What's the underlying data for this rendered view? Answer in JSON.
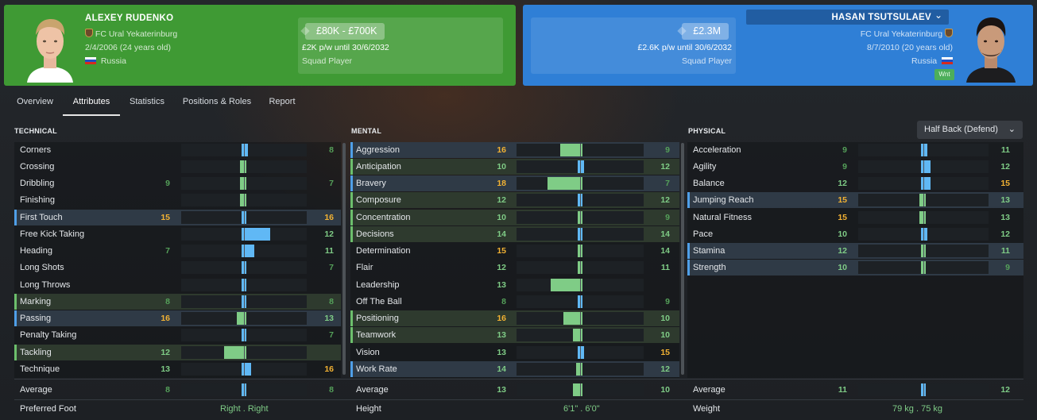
{
  "left_player": {
    "name": "ALEXEY RUDENKO",
    "club": "FC Ural Yekaterinburg",
    "dob": "2/4/2006 (24 years old)",
    "nationality": "Russia",
    "value": "£80K - £700K",
    "wage": "£2K p/w until 30/6/2032",
    "status": "Squad Player"
  },
  "right_player": {
    "name": "HASAN TSUTSULAEV",
    "club": "FC Ural Yekaterinburg",
    "dob": "8/7/2010 (20 years old)",
    "nationality": "Russia",
    "value": "£2.3M",
    "wage": "£2.6K p/w until 30/6/2032",
    "status": "Squad Player",
    "badge": "Wnt",
    "chevron": "⌄"
  },
  "tabs": [
    "Overview",
    "Attributes",
    "Statistics",
    "Positions & Roles",
    "Report"
  ],
  "active_tab": 1,
  "sections": {
    "technical": "TECHNICAL",
    "mental": "MENTAL",
    "physical": "PHYSICAL"
  },
  "role_dropdown": {
    "value": "Half Back (Defend)",
    "chevron": "⌄"
  },
  "colors": {
    "left_card": "#3f9a34",
    "right_card": "#2f7fd6",
    "left_bar": "#60b8f5",
    "right_bar": "#7fcc86",
    "high": "#f2b233"
  },
  "technical": [
    {
      "name": "Corners",
      "a": "",
      "b": "8",
      "bias": 0.1
    },
    {
      "name": "Crossing",
      "a": "",
      "b": "",
      "bias": -0.1
    },
    {
      "name": "Dribbling",
      "a": "9",
      "b": "7",
      "bias": -0.1
    },
    {
      "name": "Finishing",
      "a": "",
      "b": "",
      "bias": -0.1
    },
    {
      "name": "First Touch",
      "a": "15",
      "b": "16",
      "bias": 0.05,
      "hl": "b"
    },
    {
      "name": "Free Kick Taking",
      "a": "",
      "b": "12",
      "bias": 0.45
    },
    {
      "name": "Heading",
      "a": "7",
      "b": "11",
      "bias": 0.2
    },
    {
      "name": "Long Shots",
      "a": "",
      "b": "7",
      "bias": 0.05
    },
    {
      "name": "Long Throws",
      "a": "",
      "b": "",
      "bias": 0
    },
    {
      "name": "Marking",
      "a": "8",
      "b": "8",
      "bias": 0,
      "hl": "g"
    },
    {
      "name": "Passing",
      "a": "16",
      "b": "13",
      "bias": -0.15,
      "hl": "b"
    },
    {
      "name": "Penalty Taking",
      "a": "",
      "b": "7",
      "bias": 0.05
    },
    {
      "name": "Tackling",
      "a": "12",
      "b": "",
      "bias": -0.35,
      "hl": "g"
    },
    {
      "name": "Technique",
      "a": "13",
      "b": "16",
      "bias": 0.15
    }
  ],
  "mental": [
    {
      "name": "Aggression",
      "a": "16",
      "b": "9",
      "bias": -0.35,
      "hl": "b"
    },
    {
      "name": "Anticipation",
      "a": "10",
      "b": "12",
      "bias": 0.1,
      "hl": "g"
    },
    {
      "name": "Bravery",
      "a": "18",
      "b": "7",
      "bias": -0.55,
      "hl": "b"
    },
    {
      "name": "Composure",
      "a": "12",
      "b": "12",
      "bias": 0,
      "hl": "g"
    },
    {
      "name": "Concentration",
      "a": "10",
      "b": "9",
      "bias": -0.05,
      "hl": "g"
    },
    {
      "name": "Decisions",
      "a": "14",
      "b": "14",
      "bias": 0,
      "hl": "g"
    },
    {
      "name": "Determination",
      "a": "15",
      "b": "14",
      "bias": -0.05
    },
    {
      "name": "Flair",
      "a": "12",
      "b": "11",
      "bias": -0.05
    },
    {
      "name": "Leadership",
      "a": "13",
      "b": "",
      "bias": -0.5
    },
    {
      "name": "Off The Ball",
      "a": "8",
      "b": "9",
      "bias": 0.05
    },
    {
      "name": "Positioning",
      "a": "16",
      "b": "10",
      "bias": -0.3,
      "hl": "g"
    },
    {
      "name": "Teamwork",
      "a": "13",
      "b": "10",
      "bias": -0.15,
      "hl": "g"
    },
    {
      "name": "Vision",
      "a": "13",
      "b": "15",
      "bias": 0.1
    },
    {
      "name": "Work Rate",
      "a": "14",
      "b": "12",
      "bias": -0.1,
      "hl": "b"
    }
  ],
  "physical": [
    {
      "name": "Acceleration",
      "a": "9",
      "b": "11",
      "bias": 0.1
    },
    {
      "name": "Agility",
      "a": "9",
      "b": "12",
      "bias": 0.15
    },
    {
      "name": "Balance",
      "a": "12",
      "b": "15",
      "bias": 0.15
    },
    {
      "name": "Jumping Reach",
      "a": "15",
      "b": "13",
      "bias": -0.1,
      "hl": "b"
    },
    {
      "name": "Natural Fitness",
      "a": "15",
      "b": "13",
      "bias": -0.1
    },
    {
      "name": "Pace",
      "a": "10",
      "b": "12",
      "bias": 0.1
    },
    {
      "name": "Stamina",
      "a": "12",
      "b": "11",
      "bias": -0.05,
      "hl": "b"
    },
    {
      "name": "Strength",
      "a": "10",
      "b": "9",
      "bias": -0.05,
      "hl": "b"
    }
  ],
  "averages": {
    "label": "Average",
    "technical": {
      "a": "8",
      "b": "8",
      "bias": 0
    },
    "mental": {
      "a": "13",
      "b": "10",
      "bias": -0.15
    },
    "physical": {
      "a": "11",
      "b": "12",
      "bias": 0.05
    }
  },
  "footer": {
    "foot_label": "Preferred Foot",
    "foot_value": "Right . Right",
    "height_label": "Height",
    "height_value": "6'1\" . 6'0\"",
    "weight_label": "Weight",
    "weight_value": "79 kg . 75 kg"
  }
}
